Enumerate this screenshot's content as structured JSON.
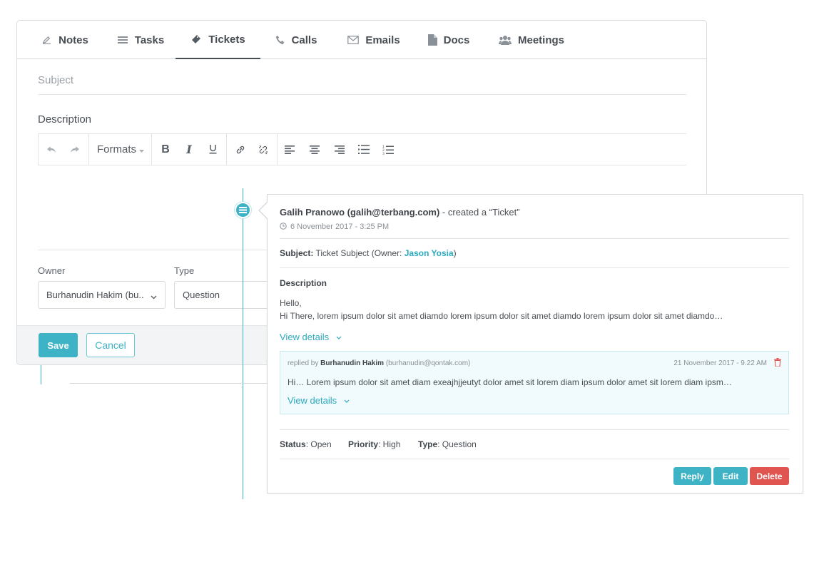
{
  "tabs": [
    {
      "label": "Notes",
      "icon": "pencil-icon"
    },
    {
      "label": "Tasks",
      "icon": "list-icon"
    },
    {
      "label": "Tickets",
      "icon": "ticket-icon",
      "active": true
    },
    {
      "label": "Calls",
      "icon": "phone-icon"
    },
    {
      "label": "Emails",
      "icon": "envelope-icon"
    },
    {
      "label": "Docs",
      "icon": "document-icon"
    },
    {
      "label": "Meetings",
      "icon": "users-icon"
    }
  ],
  "form": {
    "subject_placeholder": "Subject",
    "description_label": "Description",
    "toolbar": {
      "formats_label": "Formats"
    },
    "owner_label": "Owner",
    "owner_value": "Burhanudin Hakim (bu..",
    "type_label": "Type",
    "type_value": "Question",
    "save_label": "Save",
    "cancel_label": "Cancel"
  },
  "activity": {
    "actor": "Galih Pranowo (galih@terbang.com)",
    "action": " - created a “Ticket”",
    "timestamp": "6 November 2017 - 3:25 PM",
    "subject_key": "Subject:",
    "subject_value": " Ticket Subject (Owner: ",
    "owner_name": "Jason Yosia",
    "subject_close": ")",
    "description_label": "Description",
    "description_line1": "Hello,",
    "description_line2": "Hi There, lorem ipsum dolor sit amet diamdo lorem ipsum dolor sit amet diamdo lorem ipsum dolor sit amet diamdo…",
    "view_details": "View details",
    "reply": {
      "prefix": "replied by ",
      "author": "Burhanudin Hakim",
      "email": " (burhanudin@qontak.com)",
      "timestamp": "21 November 2017 - 9.22 AM",
      "text": "Hi… Lorem ipsum dolor sit amet diam exeajhjjeutyt dolor amet sit lorem diam ipsum dolor amet sit lorem diam ipsm…",
      "view_details": "View details"
    },
    "status_key": "Status",
    "status_value": ": Open",
    "priority_key": "Priority",
    "priority_value": ": High",
    "type_key": "Type",
    "type_value": ": Question",
    "reply_label": "Reply",
    "edit_label": "Edit",
    "delete_label": "Delete"
  },
  "colors": {
    "accent": "#3eb3c5",
    "danger": "#e05550",
    "text": "#4a4f55"
  }
}
